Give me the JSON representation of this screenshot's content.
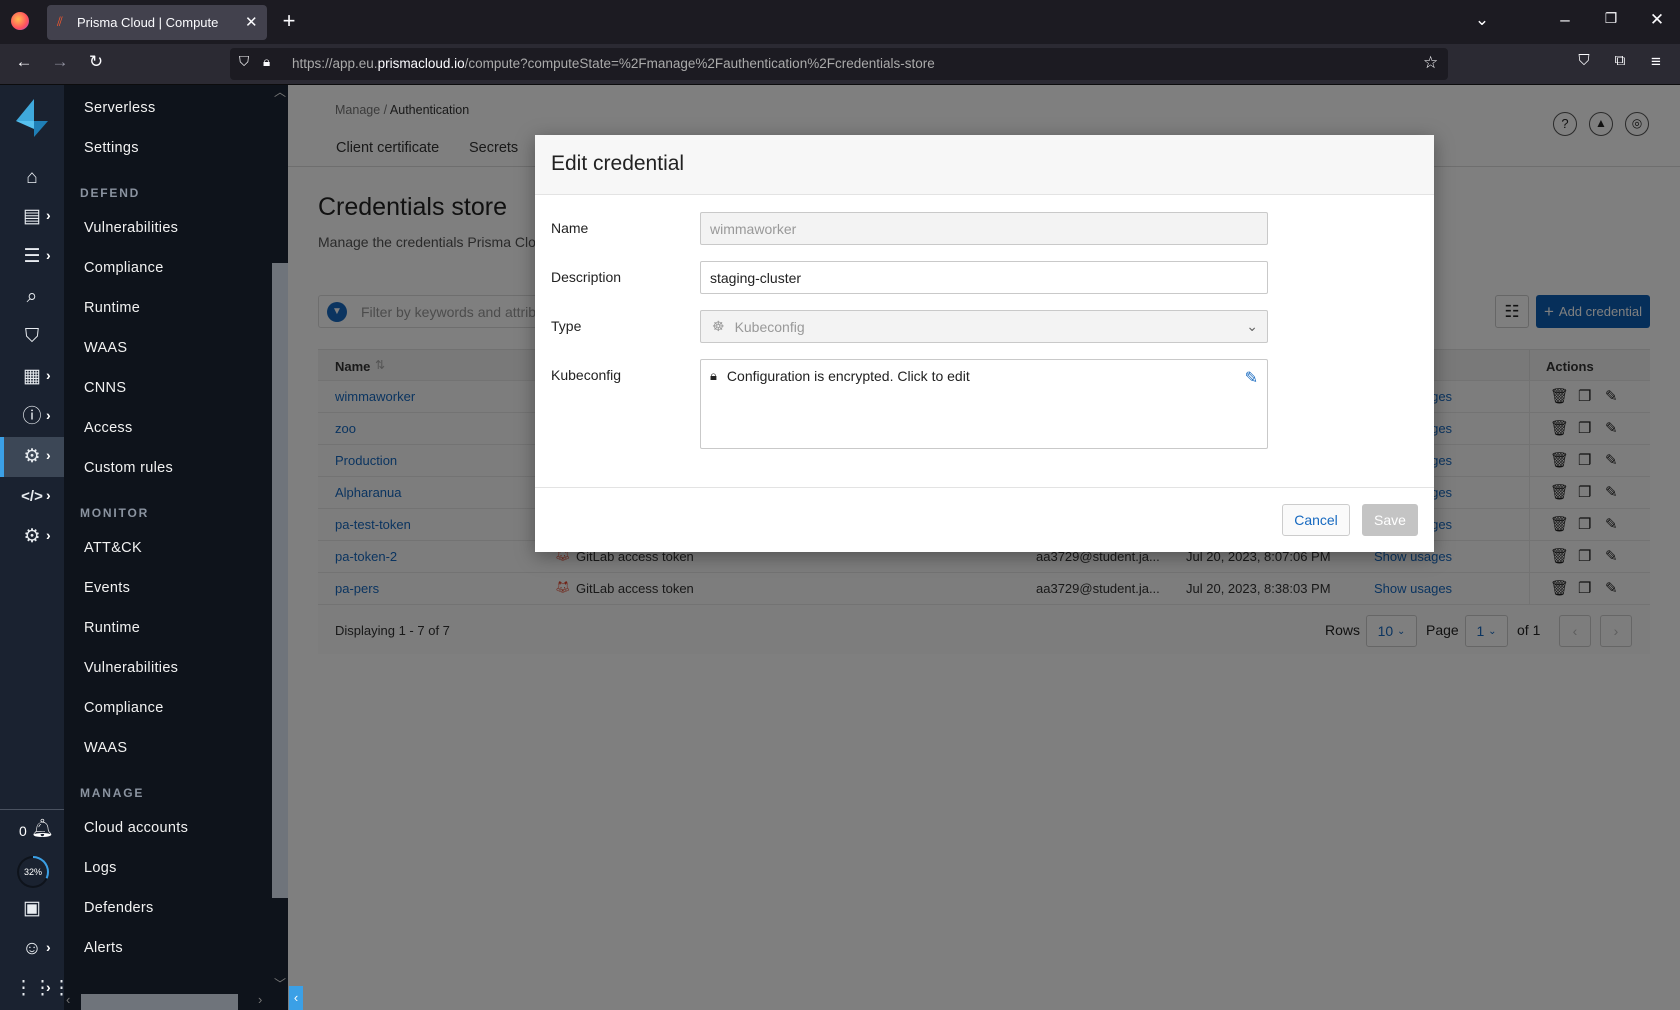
{
  "browser": {
    "tab_title": "Prisma Cloud | Compute",
    "url_prefix": "https://app.eu.",
    "url_domain": "prismacloud.io",
    "url_path": "/compute?computeState=%2Fmanage%2Fauthentication%2Fcredentials-store"
  },
  "rail": {
    "notifications_count": "0",
    "progress_label": "32%",
    "progress": 0.32
  },
  "nav": {
    "items": [
      {
        "type": "item",
        "label": "Serverless"
      },
      {
        "type": "item",
        "label": "Settings"
      },
      {
        "type": "section",
        "label": "DEFEND"
      },
      {
        "type": "item",
        "label": "Vulnerabilities"
      },
      {
        "type": "item",
        "label": "Compliance"
      },
      {
        "type": "item",
        "label": "Runtime"
      },
      {
        "type": "item",
        "label": "WAAS"
      },
      {
        "type": "item",
        "label": "CNNS"
      },
      {
        "type": "item",
        "label": "Access"
      },
      {
        "type": "item",
        "label": "Custom rules"
      },
      {
        "type": "section",
        "label": "MONITOR"
      },
      {
        "type": "item",
        "label": "ATT&CK"
      },
      {
        "type": "item",
        "label": "Events"
      },
      {
        "type": "item",
        "label": "Runtime"
      },
      {
        "type": "item",
        "label": "Vulnerabilities"
      },
      {
        "type": "item",
        "label": "Compliance"
      },
      {
        "type": "item",
        "label": "WAAS"
      },
      {
        "type": "section",
        "label": "MANAGE"
      },
      {
        "type": "item",
        "label": "Cloud accounts"
      },
      {
        "type": "item",
        "label": "Logs"
      },
      {
        "type": "item",
        "label": "Defenders"
      },
      {
        "type": "item",
        "label": "Alerts"
      }
    ]
  },
  "page": {
    "breadcrumb_parent": "Manage",
    "breadcrumb_sep": " / ",
    "breadcrumb_current": "Authentication",
    "tabs": [
      "Client certificate",
      "Secrets"
    ],
    "title": "Credentials store",
    "subtitle": "Manage the credentials Prisma Clou",
    "filter_placeholder": "Filter by keywords and attrib",
    "add_button": "Add credential",
    "columns": {
      "name": "Name",
      "actions": "Actions"
    },
    "rows": [
      {
        "name": "wimmaworker",
        "type": "",
        "owner": "",
        "date": "",
        "usages": "Show usages"
      },
      {
        "name": "zoo",
        "type": "",
        "owner": "",
        "date": "",
        "usages": "Show usages"
      },
      {
        "name": "Production",
        "type": "",
        "owner": "",
        "date": "",
        "usages": "Show usages"
      },
      {
        "name": "Alpharanua",
        "type": "",
        "owner": "",
        "date": "",
        "usages": "Show usages"
      },
      {
        "name": "pa-test-token",
        "type": "",
        "owner": "",
        "date": "",
        "usages": "Show usages"
      },
      {
        "name": "pa-token-2",
        "type": "GitLab access token",
        "owner": "aa3729@student.ja...",
        "date": "Jul 20, 2023, 8:07:06 PM",
        "usages": "Show usages"
      },
      {
        "name": "pa-pers",
        "type": "GitLab access token",
        "owner": "aa3729@student.ja...",
        "date": "Jul 20, 2023, 8:38:03 PM",
        "usages": "Show usages"
      }
    ],
    "footer": {
      "displaying": "Displaying 1 - 7 of 7",
      "rows_label": "Rows",
      "rows_value": "10",
      "page_label": "Page",
      "page_value": "1",
      "of_label": "of 1"
    }
  },
  "modal": {
    "title": "Edit credential",
    "name_label": "Name",
    "name_value": "wimmaworker",
    "description_label": "Description",
    "description_value": "staging-cluster",
    "type_label": "Type",
    "type_value": "Kubeconfig",
    "kubeconfig_label": "Kubeconfig",
    "kubeconfig_text": "Configuration is encrypted. Click to edit",
    "cancel": "Cancel",
    "save": "Save"
  },
  "colors": {
    "accent": "#1669c0",
    "add_button": "#0d5fb5",
    "rail_active": "#3ba0e6"
  }
}
